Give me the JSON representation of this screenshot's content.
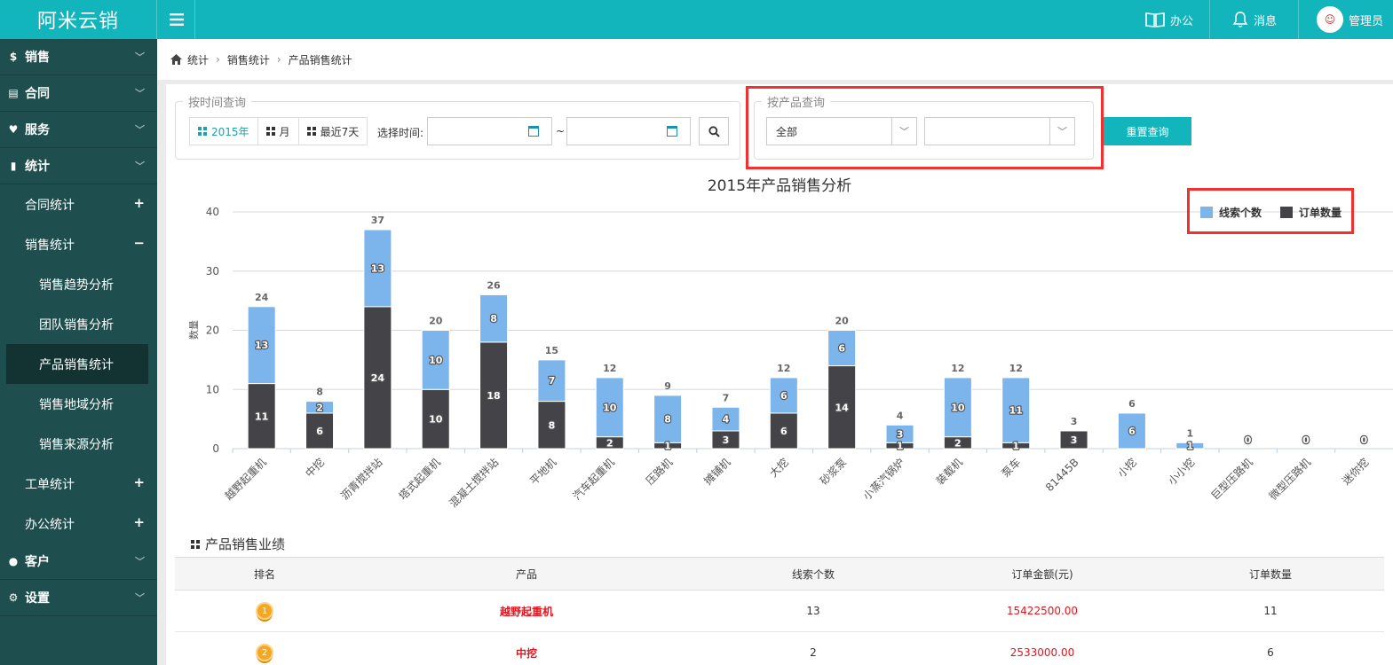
{
  "app": {
    "logo_text": "阿米云销"
  },
  "topbar": {
    "office": "办公",
    "messages": "消息",
    "user": "管理员"
  },
  "sidebar": {
    "sales": "销售",
    "contract": "合同",
    "service": "服务",
    "stats": "统计",
    "contract_stats": "合同统计",
    "sales_stats": "销售统计",
    "trend": "销售趋势分析",
    "team": "团队销售分析",
    "product": "产品销售统计",
    "region": "销售地域分析",
    "source": "销售来源分析",
    "ticket_stats": "工单统计",
    "office_stats": "办公统计",
    "customer": "客户",
    "settings": "设置"
  },
  "breadcrumb": [
    "统计",
    "销售统计",
    "产品销售统计"
  ],
  "time_query": {
    "legend": "按时间查询",
    "year": "2015年",
    "month": "月",
    "last7": "最近7天",
    "select_time": "选择时间:",
    "tilde": "~"
  },
  "product_query": {
    "legend": "按产品查询",
    "category": "全部",
    "product": ""
  },
  "reset_button": "重置查询",
  "chart_data": {
    "type": "bar",
    "stacked": true,
    "title": "2015年产品销售分析",
    "ylabel": "数量",
    "ylim": [
      0,
      40
    ],
    "yticks": [
      0,
      10,
      20,
      30,
      40
    ],
    "categories": [
      "越野起重机",
      "中挖",
      "沥青搅拌站",
      "塔式起重机",
      "混凝土搅拌站",
      "平地机",
      "汽车起重机",
      "压路机",
      "摊铺机",
      "大挖",
      "砂浆泵",
      "小蒸汽锅炉",
      "装载机",
      "泵车",
      "81445B",
      "小挖",
      "小小挖",
      "巨型压路机",
      "微型压路机",
      "迷你挖"
    ],
    "series": [
      {
        "name": "订单数量",
        "color": "#434348",
        "values": [
          11,
          6,
          24,
          10,
          18,
          8,
          2,
          1,
          3,
          6,
          14,
          1,
          2,
          1,
          3,
          0,
          0,
          0,
          0,
          0
        ]
      },
      {
        "name": "线索个数",
        "color": "#7cb5ec",
        "values": [
          13,
          2,
          13,
          10,
          8,
          7,
          10,
          8,
          4,
          6,
          6,
          3,
          10,
          11,
          0,
          6,
          1,
          0,
          0,
          0
        ]
      }
    ],
    "legend_position": "top-right",
    "legend": [
      "线索个数",
      "订单数量"
    ],
    "grid": true
  },
  "performance": {
    "title": "产品销售业绩",
    "headers": [
      "排名",
      "产品",
      "线索个数",
      "订单金额(元)",
      "订单数量"
    ],
    "rows": [
      {
        "rank": "1",
        "product": "越野起重机",
        "leads": "13",
        "amount": "15422500.00",
        "orders": "11"
      },
      {
        "rank": "2",
        "product": "中挖",
        "leads": "2",
        "amount": "2533000.00",
        "orders": "6"
      }
    ]
  }
}
